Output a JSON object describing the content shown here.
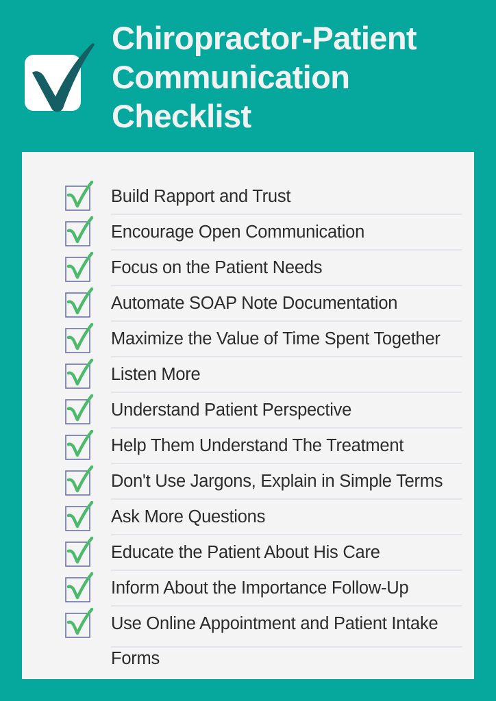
{
  "theme": {
    "background_color": "#06a79c",
    "panel_color": "#f4f4f4",
    "title_color": "#f1f3f2",
    "item_text_color": "#2c2c2c",
    "checkbox_border_color": "#6b72a8",
    "checkmark_color": "#4cb96b",
    "logo_check_color": "#155e63",
    "logo_box_color": "#ffffff",
    "divider_color": "#e2e5ea"
  },
  "header": {
    "title": "Chiropractor-Patient\nCommunication\nChecklist",
    "logo_icon": "checkbox-check-icon"
  },
  "checklist": {
    "item_icon": "checkbox-checked-icon",
    "items": [
      {
        "label": "Build Rapport and Trust"
      },
      {
        "label": "Encourage Open Communication"
      },
      {
        "label": "Focus on the Patient Needs"
      },
      {
        "label": "Automate SOAP Note Documentation"
      },
      {
        "label": "Maximize the Value of Time Spent Together"
      },
      {
        "label": "Listen More"
      },
      {
        "label": "Understand Patient Perspective"
      },
      {
        "label": "Help Them Understand The Treatment"
      },
      {
        "label": "Don't Use Jargons, Explain in Simple Terms"
      },
      {
        "label": "Ask More Questions"
      },
      {
        "label": "Educate the Patient About His Care"
      },
      {
        "label": "Inform About the Importance Follow-Up"
      },
      {
        "label": "Use Online Appointment and Patient Intake Forms"
      }
    ]
  }
}
